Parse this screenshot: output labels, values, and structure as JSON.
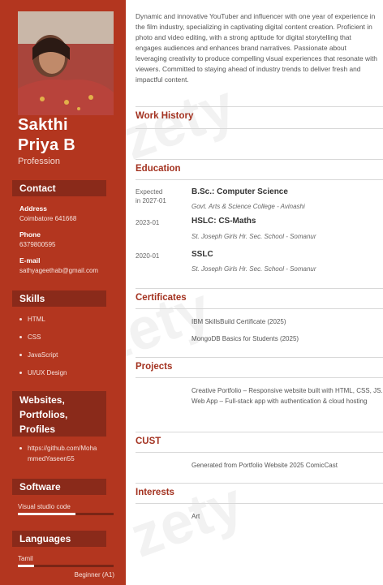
{
  "sidebar": {
    "name_line1": "Sakthi",
    "name_line2": "Priya B",
    "profession": "Profession",
    "contact": {
      "heading": "Contact",
      "address_label": "Address",
      "address_value": "Coimbatore 641668",
      "phone_label": "Phone",
      "phone_value": "6379800595",
      "email_label": "E-mail",
      "email_value": "sathyageethab@gmail.com"
    },
    "skills": {
      "heading": "Skills",
      "items": [
        "HTML",
        "CSS",
        "JavaScript",
        "UI/UX Design"
      ]
    },
    "websites": {
      "heading_line1": "Websites,",
      "heading_line2": "Portfolios,",
      "heading_line3": "Profiles",
      "link_line1": "https://github.com/Moha",
      "link_line2": "mmedYaseen55"
    },
    "software": {
      "heading": "Software",
      "item": "Visual studio code",
      "level": 0.6
    },
    "languages": {
      "heading": "Languages",
      "item": "Tamil",
      "level": 0.17,
      "level_label": "Beginner (A1)"
    }
  },
  "main": {
    "summary": "Dynamic and innovative YouTuber and influencer with one year of experience in the film industry, specializing in captivating digital content creation. Proficient in photo and video editing, with a strong aptitude for digital storytelling that engages audiences and enhances brand narratives. Passionate about leveraging creativity to produce compelling visual experiences that resonate with viewers. Committed to staying ahead of industry trends to deliver fresh and impactful content.",
    "work_history_heading": "Work History",
    "education": {
      "heading": "Education",
      "entries": [
        {
          "date_line1": "Expected",
          "date_line2": "in 2027-01",
          "degree": "B.Sc.: Computer Science",
          "institution": "Govt. Arts & Science College - Avinashi"
        },
        {
          "date_line1": "2023-01",
          "degree": "HSLC: CS-Maths",
          "institution": "St. Joseph Girls Hr. Sec. School - Somanur"
        },
        {
          "date_line1": "2020-01",
          "degree": "SSLC",
          "institution": "St. Joseph Girls Hr. Sec. School - Somanur"
        }
      ]
    },
    "certificates": {
      "heading": "Certificates",
      "items": [
        "IBM SkillsBuild Certificate (2025)",
        "MongoDB Basics for Students (2025)"
      ]
    },
    "projects": {
      "heading": "Projects",
      "text": "Creative Portfolio – Responsive website built with HTML, CSS, JS. Web App – Full-stack app with authentication & cloud hosting"
    },
    "cust": {
      "heading": "CUST",
      "text": "Generated from Portfolio Website 2025 ComicCast"
    },
    "interests": {
      "heading": "Interests",
      "text": "Art"
    }
  },
  "watermark": "zety",
  "colors": {
    "sidebar": "#b3361f",
    "sidebar_heading": "#8a2a1a",
    "accent": "#a33220"
  }
}
